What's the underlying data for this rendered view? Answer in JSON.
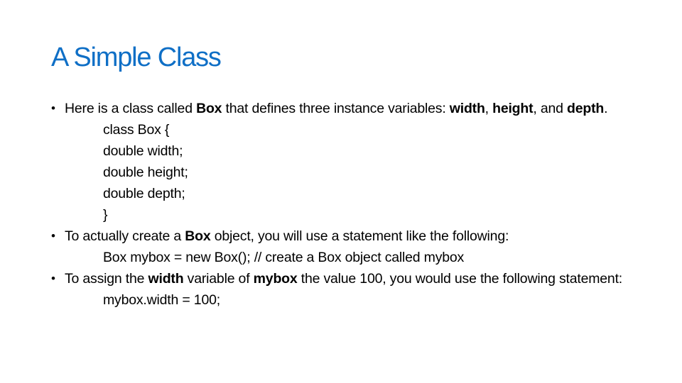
{
  "slide": {
    "title": "A Simple Class",
    "title_color": "#0f6fc6",
    "bullets": [
      {
        "segments": [
          {
            "text": "Here is a class called ",
            "bold": false
          },
          {
            "text": "Box",
            "bold": true
          },
          {
            "text": " that defines three instance variables: ",
            "bold": false
          },
          {
            "text": "width",
            "bold": true
          },
          {
            "text": ", ",
            "bold": false
          },
          {
            "text": "height",
            "bold": true
          },
          {
            "text": ", and ",
            "bold": false
          },
          {
            "text": "depth",
            "bold": true
          },
          {
            "text": ".",
            "bold": false
          }
        ],
        "code": [
          "class Box {",
          "double width;",
          "double height;",
          "double depth;",
          "}"
        ]
      },
      {
        "segments": [
          {
            "text": "To actually create a ",
            "bold": false
          },
          {
            "text": "Box",
            "bold": true
          },
          {
            "text": " object, you will use a statement like the following:",
            "bold": false
          }
        ],
        "code": [
          "Box mybox = new Box(); // create a Box object called mybox"
        ]
      },
      {
        "segments": [
          {
            "text": "To assign the ",
            "bold": false
          },
          {
            "text": "width",
            "bold": true
          },
          {
            "text": " variable of ",
            "bold": false
          },
          {
            "text": "mybox",
            "bold": true
          },
          {
            "text": " the value 100, you would use the following statement:",
            "bold": false
          }
        ],
        "code": [
          "mybox.width = 100;"
        ]
      }
    ]
  }
}
